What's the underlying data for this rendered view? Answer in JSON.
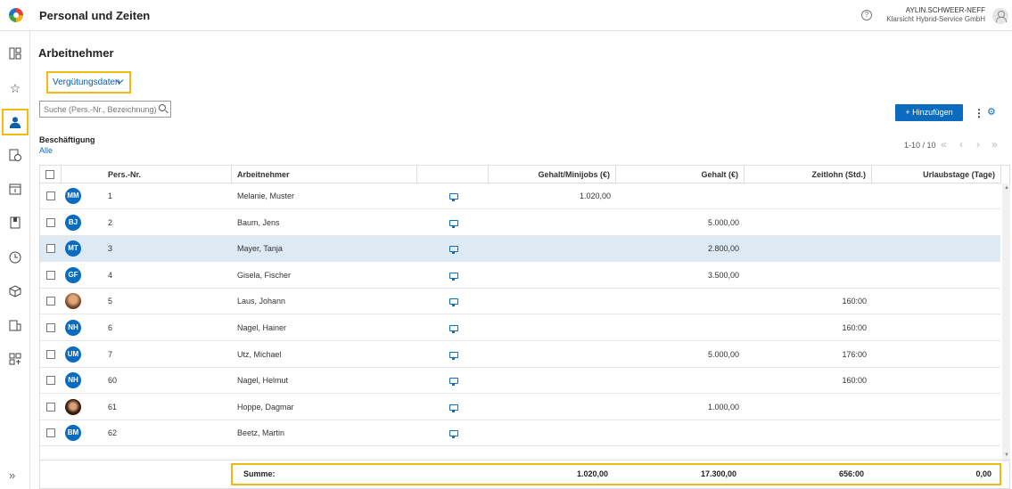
{
  "app": {
    "title": "Personal und Zeiten"
  },
  "user": {
    "name": "AYLIN.SCHWEER-NEFF",
    "company": "Klarsicht Hybrid-Service GmbH"
  },
  "page": {
    "title": "Arbeitnehmer"
  },
  "view_select": {
    "label": "Vergütungsdaten"
  },
  "search": {
    "placeholder": "Suche (Pers.-Nr., Bezeichnung)"
  },
  "toolbar": {
    "add_label": "Hinzufügen",
    "add_icon": "+"
  },
  "filter": {
    "label": "Beschäftigung",
    "value": "Alle"
  },
  "pager": {
    "text": "1-10 / 10"
  },
  "sidebar": {
    "icons": [
      "dashboard-icon",
      "star-icon",
      "person-icon",
      "document-clock-icon",
      "calendar-icon",
      "book-icon",
      "clock-icon",
      "cube-icon",
      "building-icon",
      "report-icon"
    ],
    "active": "person-icon",
    "collapse": "»"
  },
  "table": {
    "columns": [
      "Pers.-Nr.",
      "Arbeitnehmer",
      "Gehalt/Minijobs (€)",
      "Gehalt (€)",
      "Zeitlohn (Std.)",
      "Urlaubstage (Tage)"
    ],
    "rows": [
      {
        "initials": "MM",
        "photo": false,
        "nr": "1",
        "name": "Melanie, Muster",
        "minijob": "1.020,00",
        "gehalt": "",
        "zeitlohn": "",
        "urlaub": ""
      },
      {
        "initials": "BJ",
        "photo": false,
        "nr": "2",
        "name": "Baum, Jens",
        "minijob": "",
        "gehalt": "5.000,00",
        "zeitlohn": "",
        "urlaub": ""
      },
      {
        "initials": "MT",
        "photo": false,
        "nr": "3",
        "name": "Mayer, Tanja",
        "minijob": "",
        "gehalt": "2.800,00",
        "zeitlohn": "",
        "urlaub": "",
        "selected": true
      },
      {
        "initials": "GF",
        "photo": false,
        "nr": "4",
        "name": "Gisela, Fischer",
        "minijob": "",
        "gehalt": "3.500,00",
        "zeitlohn": "",
        "urlaub": ""
      },
      {
        "initials": "",
        "photo": true,
        "nr": "5",
        "name": "Laus, Johann",
        "minijob": "",
        "gehalt": "",
        "zeitlohn": "160:00",
        "urlaub": ""
      },
      {
        "initials": "NH",
        "photo": false,
        "nr": "6",
        "name": "Nagel, Hainer",
        "minijob": "",
        "gehalt": "",
        "zeitlohn": "160:00",
        "urlaub": ""
      },
      {
        "initials": "UM",
        "photo": false,
        "nr": "7",
        "name": "Utz, Michael",
        "minijob": "",
        "gehalt": "5.000,00",
        "zeitlohn": "176:00",
        "urlaub": ""
      },
      {
        "initials": "NH",
        "photo": false,
        "nr": "60",
        "name": "Nagel, Helmut",
        "minijob": "",
        "gehalt": "",
        "zeitlohn": "160:00",
        "urlaub": ""
      },
      {
        "initials": "",
        "photo": true,
        "nr": "61",
        "name": "Hoppe, Dagmar",
        "minijob": "",
        "gehalt": "1.000,00",
        "zeitlohn": "",
        "urlaub": ""
      },
      {
        "initials": "BM",
        "photo": false,
        "nr": "62",
        "name": "Beetz, Martin",
        "minijob": "",
        "gehalt": "",
        "zeitlohn": "",
        "urlaub": ""
      }
    ],
    "summary": {
      "label": "Summe:",
      "minijob": "1.020,00",
      "gehalt": "17.300,00",
      "zeitlohn": "656:00",
      "urlaub": "0,00"
    }
  },
  "colors": {
    "accent": "#0b6bbf",
    "highlight": "#f2b90e",
    "selected_row": "#dde9f3"
  }
}
